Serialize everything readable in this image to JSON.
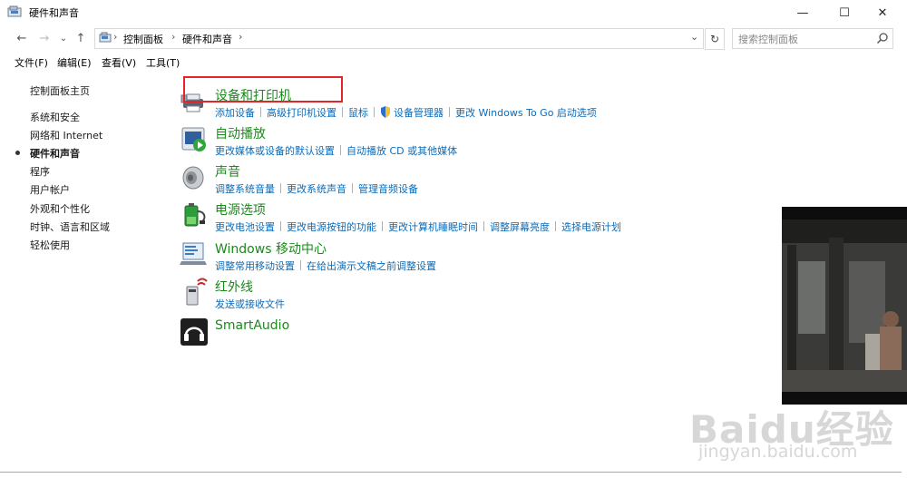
{
  "window": {
    "title": "硬件和声音"
  },
  "titlebar": {
    "minimize": "—",
    "maximize": "☐",
    "close": "✕"
  },
  "nav": {
    "back": "←",
    "forward": "→",
    "recent": "⌄",
    "up": "↑"
  },
  "address": {
    "crumbs": [
      "控制面板",
      "硬件和声音"
    ],
    "sep": "›",
    "dropdown": "⌄",
    "refresh": "↻"
  },
  "search": {
    "placeholder": "搜索控制面板"
  },
  "menu": [
    "文件(F)",
    "编辑(E)",
    "查看(V)",
    "工具(T)"
  ],
  "leftnav": {
    "home": "控制面板主页",
    "items": [
      "系统和安全",
      "网络和 Internet",
      "硬件和声音",
      "程序",
      "用户帐户",
      "外观和个性化",
      "时钟、语言和区域",
      "轻松使用"
    ],
    "current_index": 2
  },
  "categories": [
    {
      "title": "设备和打印机",
      "links": [
        "添加设备",
        "高级打印机设置",
        "鼠标",
        "设备管理器",
        "更改 Windows To Go 启动选项"
      ]
    },
    {
      "title": "自动播放",
      "links": [
        "更改媒体或设备的默认设置",
        "自动播放 CD 或其他媒体"
      ]
    },
    {
      "title": "声音",
      "links": [
        "调整系统音量",
        "更改系统声音",
        "管理音频设备"
      ]
    },
    {
      "title": "电源选项",
      "links": [
        "更改电池设置",
        "更改电源按钮的功能",
        "更改计算机睡眠时间",
        "调整屏幕亮度",
        "选择电源计划"
      ]
    },
    {
      "title": "Windows 移动中心",
      "links": [
        "调整常用移动设置",
        "在给出演示文稿之前调整设置"
      ]
    },
    {
      "title": "红外线",
      "links": [
        "发送或接收文件"
      ]
    },
    {
      "title": "SmartAudio",
      "links": []
    }
  ],
  "watermark": {
    "logo": "Baidu经验",
    "url": "jingyan.baidu.com"
  },
  "colors": {
    "category_title": "#1a8a1a",
    "link": "#0b6bb8",
    "highlight": "#e0262b"
  }
}
